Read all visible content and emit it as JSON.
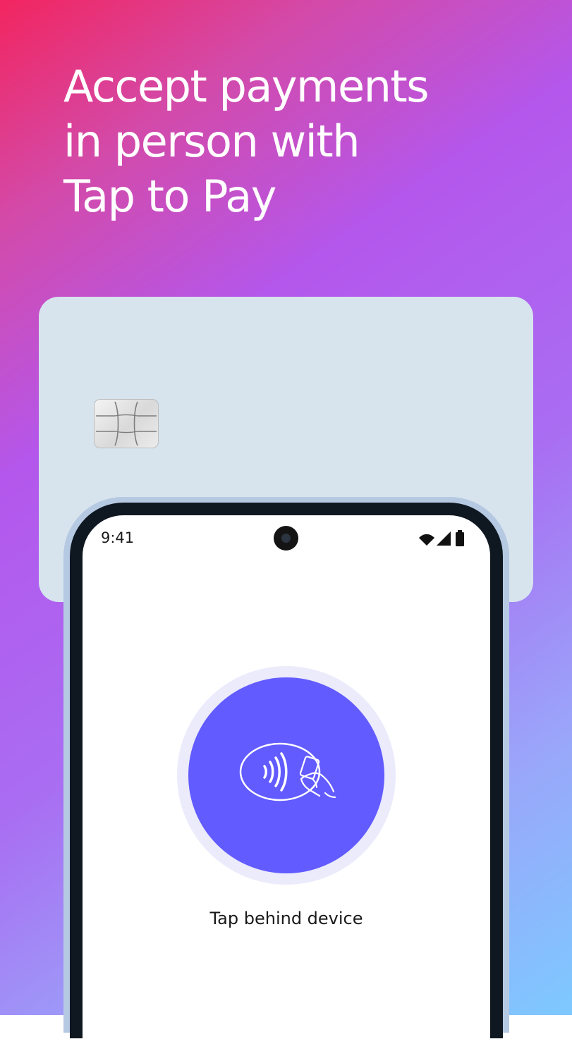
{
  "headline": {
    "lines": [
      "Accept payments",
      "in person with",
      "Tap to Pay"
    ]
  },
  "card": {
    "chip_icon": "card-chip-icon"
  },
  "phone": {
    "status_bar": {
      "time": "9:41",
      "icons": [
        "wifi-icon",
        "signal-icon",
        "battery-icon"
      ]
    },
    "tap_prompt": {
      "icon": "contactless-tap-icon",
      "label": "Tap behind device"
    }
  },
  "colors": {
    "gradient_start": "#f2255f",
    "gradient_mid": "#b457ec",
    "gradient_end": "#7dc9ff",
    "card": "#d7e4ee",
    "tap_circle": "#625bff",
    "phone_frame": "#0f1721"
  }
}
